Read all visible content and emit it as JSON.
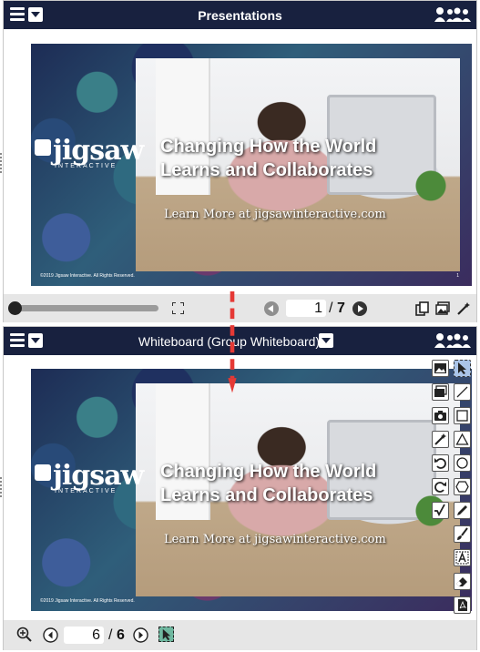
{
  "top_panel": {
    "title": "Presentations",
    "slide": {
      "headline_1": "Changing How the World",
      "headline_2": "Learns and Collaborates",
      "learn_more": "Learn More at jigsawinteractive.com",
      "logo_text": "jigsaw",
      "logo_sub": "INTERACTIVE",
      "copyright": "©2019 Jigsaw Interactive. All Rights Reserved.",
      "slide_number": "1"
    },
    "controls": {
      "current_page": "1",
      "separator": "/",
      "total_pages": "7"
    }
  },
  "bottom_panel": {
    "title": "Whiteboard (Group Whiteboard)",
    "slide": {
      "headline_1": "Changing How the World",
      "headline_2": "Learns and Collaborates",
      "learn_more": "Learn More at jigsawinteractive.com",
      "logo_text": "jigsaw",
      "logo_sub": "INTERACTIVE",
      "copyright": "©2019 Jigsaw Interactive. All Rights Reserved."
    },
    "controls": {
      "current_page": "6",
      "separator": "/",
      "total_pages": "6"
    },
    "tools": [
      "image-icon",
      "pointer-icon",
      "images-icon",
      "line-icon",
      "camera-icon",
      "rectangle-icon",
      "magic-wand-icon",
      "triangle-icon",
      "undo-icon",
      "circle-icon",
      "redo-icon",
      "hexagon-icon",
      "checkmark-icon",
      "pencil-icon",
      "brush-icon",
      "text-icon",
      "eraser-icon",
      "pdf-icon"
    ]
  },
  "colors": {
    "titlebar": "#18213f",
    "controlbar": "#e6e6e6",
    "arrow": "#e53935"
  }
}
